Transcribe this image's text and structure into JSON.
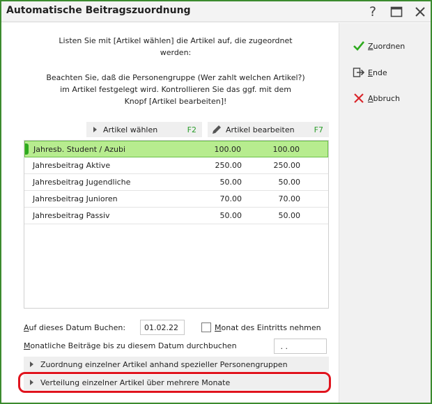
{
  "window": {
    "title": "Automatische Beitragszuordnung",
    "help_glyph": "?"
  },
  "intro": {
    "line1a": "Listen Sie mit [Artikel wählen] die Artikel auf, die zugeordnet",
    "line1b": "werden:",
    "line2a": "Beachten Sie, daß die Personengruppe (Wer zahlt welchen Artikel?)",
    "line2b": "im Artikel festgelegt wird. Kontrollieren Sie das ggf. mit dem",
    "line2c": "Knopf [Artikel bearbeiten]!"
  },
  "toolbar": {
    "select": {
      "label": "Artikel wählen",
      "key": "F2"
    },
    "edit": {
      "label": "Artikel bearbeiten",
      "key": "F7"
    }
  },
  "articles": [
    {
      "name": "Jahresb. Student / Azubi",
      "v1": "100.00",
      "v2": "100.00",
      "selected": true
    },
    {
      "name": "Jahresbeitrag Aktive",
      "v1": "250.00",
      "v2": "250.00"
    },
    {
      "name": "Jahresbeitrag Jugendliche",
      "v1": "50.00",
      "v2": "50.00"
    },
    {
      "name": "Jahresbeitrag Junioren",
      "v1": "70.00",
      "v2": "70.00"
    },
    {
      "name": "Jahresbeitrag Passiv",
      "v1": "50.00",
      "v2": "50.00"
    }
  ],
  "form": {
    "date_label": "Auf dieses Datum Buchen:",
    "date_value": "01.02.22",
    "checkbox_label": "Monat des Eintritts nehmen",
    "monthly_label": "Monatliche Beiträge bis zu diesem Datum durchbuchen",
    "monthly_value": " . ."
  },
  "expanders": {
    "group": "Zuordnung einzelner Artikel anhand spezieller Personengruppen",
    "months": "Verteilung einzelner Artikel über mehrere Monate"
  },
  "actions": {
    "assign": "Zuordnen",
    "end": "Ende",
    "cancel": "Abbruch"
  },
  "colors": {
    "accent_green": "#2eaa1e",
    "selection": "#b7ec8f",
    "highlight_red": "#e0141e"
  }
}
